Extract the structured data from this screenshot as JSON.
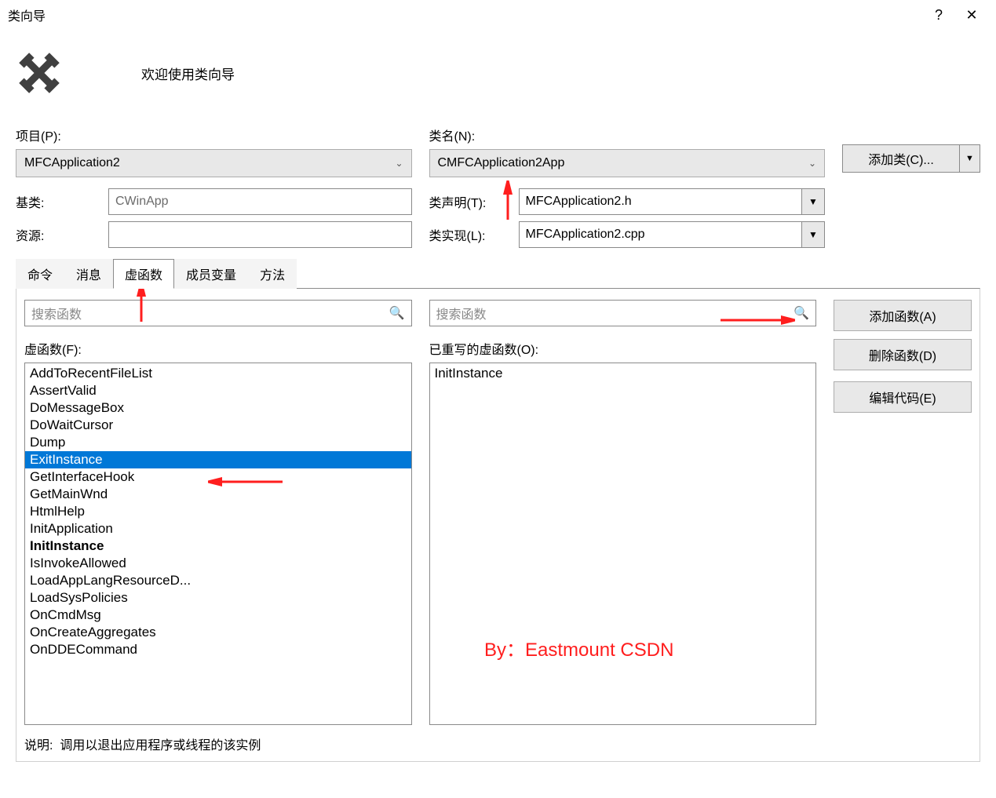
{
  "window": {
    "title": "类向导",
    "help": "?",
    "close": "✕",
    "welcome": "欢迎使用类向导"
  },
  "labels": {
    "project": "项目(P):",
    "className": "类名(N):",
    "baseClass": "基类:",
    "resource": "资源:",
    "classDecl": "类声明(T):",
    "classImpl": "类实现(L):",
    "addClass": "添加类(C)...",
    "virtualFuncs": "虚函数(F):",
    "overridden": "已重写的虚函数(O):",
    "addFunc": "添加函数(A)",
    "delFunc": "删除函数(D)",
    "editCode": "编辑代码(E)",
    "desc": "说明:",
    "searchPlaceholder": "搜索函数"
  },
  "underlineHints": {
    "project": "P",
    "className": "N",
    "classDecl": "T",
    "classImpl": "L",
    "addClass": "C",
    "virtualFuncs": "F",
    "overridden": "O",
    "addFunc": "A",
    "delFunc": "D",
    "editCode": "E"
  },
  "values": {
    "project": "MFCApplication2",
    "className": "CMFCApplication2App",
    "baseClass": "CWinApp",
    "resource": "",
    "classDecl": "MFCApplication2.h",
    "classImpl": "MFCApplication2.cpp",
    "descText": "调用以退出应用程序或线程的该实例"
  },
  "tabs": [
    {
      "id": "cmd",
      "label": "命令"
    },
    {
      "id": "msg",
      "label": "消息"
    },
    {
      "id": "virt",
      "label": "虚函数",
      "active": true
    },
    {
      "id": "member",
      "label": "成员变量"
    },
    {
      "id": "method",
      "label": "方法"
    }
  ],
  "virtualList": [
    {
      "text": "AddToRecentFileList"
    },
    {
      "text": "AssertValid"
    },
    {
      "text": "DoMessageBox"
    },
    {
      "text": "DoWaitCursor"
    },
    {
      "text": "Dump"
    },
    {
      "text": "ExitInstance",
      "selected": true
    },
    {
      "text": "GetInterfaceHook"
    },
    {
      "text": "GetMainWnd"
    },
    {
      "text": "HtmlHelp"
    },
    {
      "text": "InitApplication"
    },
    {
      "text": "InitInstance",
      "bold": true
    },
    {
      "text": "IsInvokeAllowed"
    },
    {
      "text": "LoadAppLangResourceD..."
    },
    {
      "text": "LoadSysPolicies"
    },
    {
      "text": "OnCmdMsg"
    },
    {
      "text": "OnCreateAggregates"
    },
    {
      "text": "OnDDECommand"
    }
  ],
  "overriddenList": [
    {
      "text": "InitInstance"
    }
  ],
  "watermark": "By：Eastmount CSDN"
}
